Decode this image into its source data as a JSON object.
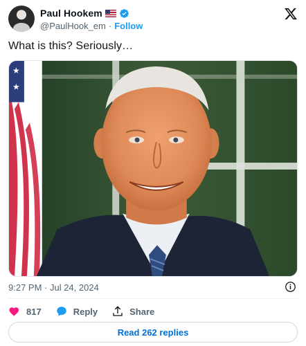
{
  "author": {
    "display_name": "Paul Hookem",
    "handle": "@PaulHook_em",
    "separator": "·",
    "follow_label": "Follow"
  },
  "tweet": {
    "text": "What is this?  Seriously…",
    "timestamp": "9:27 PM · Jul 24, 2024"
  },
  "actions": {
    "like_count": "817",
    "reply_label": "Reply",
    "share_label": "Share"
  },
  "read_replies_label": "Read 262 replies",
  "colors": {
    "link_blue": "#1d9bf0",
    "like_pink": "#f91880",
    "muted_text": "#536471"
  }
}
